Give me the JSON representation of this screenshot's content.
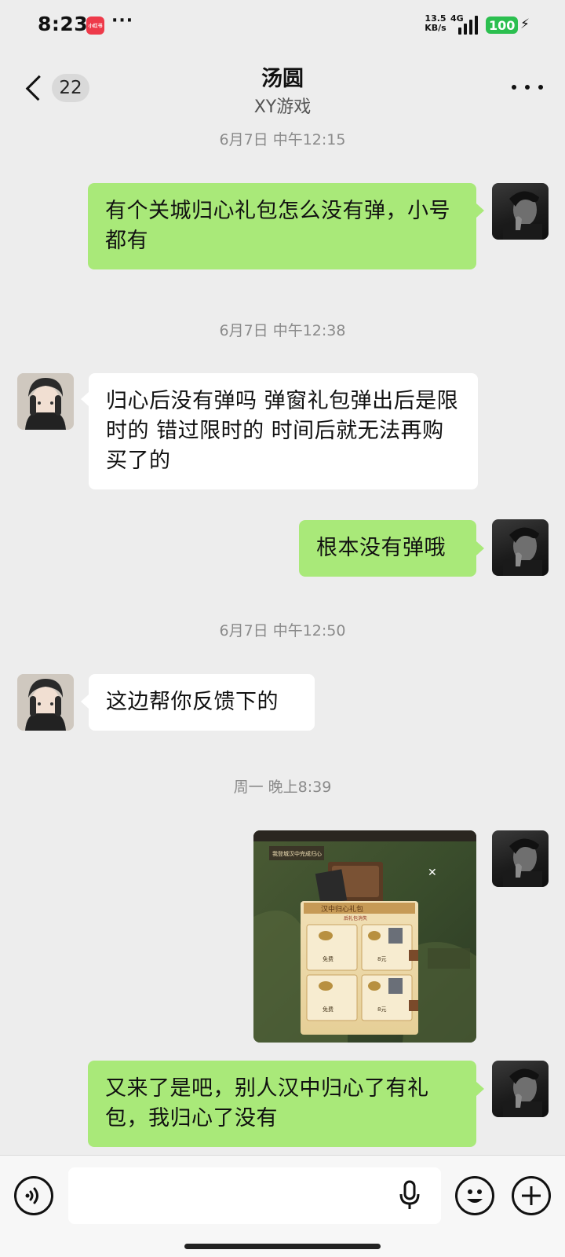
{
  "status_bar": {
    "time": "8:23",
    "app_badge": "小红书",
    "more": "···",
    "speed_value": "13.5",
    "speed_unit": "KB/s",
    "network": "4G",
    "battery": "100"
  },
  "header": {
    "back_count": "22",
    "title": "汤圆",
    "subtitle": "XY游戏"
  },
  "messages": [
    {
      "kind": "timestamp",
      "text": "6月7日 中午12:15"
    },
    {
      "kind": "text",
      "from": "me",
      "text": "有个关城归心礼包怎么没有弹，小号都有"
    },
    {
      "kind": "timestamp",
      "text": "6月7日 中午12:38"
    },
    {
      "kind": "text",
      "from": "other",
      "text": "归心后没有弹吗 弹窗礼包弹出后是限时的 错过限时的 时间后就无法再购买了的"
    },
    {
      "kind": "text",
      "from": "me",
      "text": "根本没有弹哦"
    },
    {
      "kind": "timestamp",
      "text": "6月7日 中午12:50"
    },
    {
      "kind": "text",
      "from": "other",
      "text": "这边帮你反馈下的"
    },
    {
      "kind": "timestamp",
      "text": "周一 晚上8:39"
    },
    {
      "kind": "image",
      "from": "me",
      "popup_banner": "我登城汉中完成归心",
      "popup_title": "汉中归心礼包",
      "popup_timer": "后礼包消失",
      "item_free": "免费",
      "item_price": "8元"
    },
    {
      "kind": "text",
      "from": "me",
      "text": "又来了是吧，别人汉中归心了有礼包，我归心了没有"
    }
  ],
  "input_bar": {
    "placeholder": ""
  },
  "colors": {
    "my_bubble": "#a9e979",
    "their_bubble": "#ffffff",
    "background": "#ededed",
    "battery": "#2bbf4f"
  }
}
